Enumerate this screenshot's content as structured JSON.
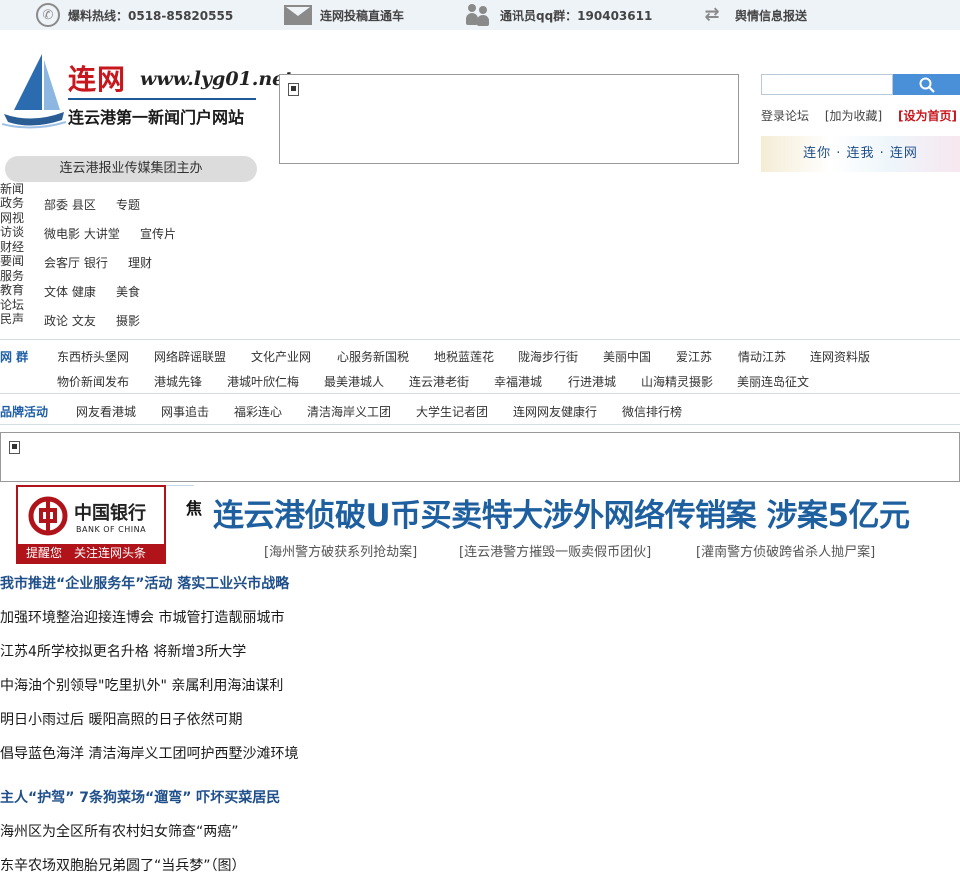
{
  "topbar": {
    "hotline": "爆料热线：0518-85820555",
    "submit": "连网投稿直通车",
    "qq": "通讯员qq群：190403611",
    "report": "舆情信息报送"
  },
  "logo": {
    "name": "连网",
    "domain": "www.lyg01.net",
    "slogan": "连云港第一新闻门户网站"
  },
  "group_label": "连云港报业传媒集团主办",
  "search": {
    "placeholder": ""
  },
  "util": {
    "forum": "登录论坛",
    "favorite": "[加为收藏]",
    "home": "[设为首页]"
  },
  "banner_text": "连你 · 连我 · 连网",
  "channels": [
    {
      "a": "新闻",
      "b": "政务",
      "links": [
        "部委 县区",
        "专题"
      ]
    },
    {
      "a": "网视",
      "b": "访谈",
      "links": [
        "微电影 大讲堂",
        "宣传片"
      ]
    },
    {
      "a": "财经",
      "b": "要闻",
      "links": [
        "会客厅 银行",
        "理财"
      ]
    },
    {
      "a": "服务",
      "b": "教育",
      "links": [
        "文体 健康",
        "美食"
      ]
    },
    {
      "a": "论坛",
      "b": "民声",
      "links": [
        "政论 文友",
        "摄影"
      ]
    }
  ],
  "network": {
    "label": "网 群",
    "row1": [
      "东西桥头堡网",
      "网络辟谣联盟",
      "文化产业网",
      "心服务新国税",
      "地税蓝莲花",
      "陇海步行街",
      "美丽中国",
      "爱江苏",
      "情动江苏",
      "连网资料版"
    ],
    "row2": [
      "物价新闻发布",
      "港城先锋",
      "港城叶欣仁梅",
      "最美港城人",
      "连云港老街",
      "幸福港城",
      "行进港城",
      "山海精灵摄影",
      "美丽连岛征文"
    ]
  },
  "brand": {
    "label": "品牌活动",
    "links": [
      "网友看港城",
      "网事追击",
      "福彩连心",
      "清洁海岸义工团",
      "大学生记者团",
      "连网网友健康行",
      "微信排行榜"
    ]
  },
  "boc": {
    "cn": "中国银行",
    "en": "BANK OF CHINA",
    "bottom": "提醒您　关注连网头条"
  },
  "headline": {
    "cut": "焦",
    "title": "连云港侦破U币买卖特大涉外网络传销案 涉案5亿元",
    "subs": [
      "[海州警方破获系列抢劫案]",
      "[连云港警方摧毁一贩卖假币团伙]",
      "[灌南警方侦破跨省杀人抛尸案]"
    ]
  },
  "news": [
    {
      "text": "我市推进“企业服务年”活动 落实工业兴市战略",
      "bold": true
    },
    {
      "text": "加强环境整治迎接连博会 市城管打造靓丽城市",
      "bold": false
    },
    {
      "text": "江苏4所学校拟更名升格 将新增3所大学",
      "bold": false
    },
    {
      "text": "中海油个别领导\"吃里扒外\" 亲属利用海油谋利",
      "bold": false
    },
    {
      "text": "明日小雨过后 暖阳高照的日子依然可期",
      "bold": false
    },
    {
      "text": "倡导蓝色海洋 清洁海岸义工团呵护西墅沙滩环境",
      "bold": false
    },
    {
      "text": "主人“护驾” 7条狗菜场“遛弯” 吓坏买菜居民",
      "bold": true
    },
    {
      "text": "海州区为全区所有农村妇女筛查“两癌”",
      "bold": false
    },
    {
      "text": "东辛农场双胞胎兄弟圆了“当兵梦”（图）",
      "bold": false
    }
  ]
}
